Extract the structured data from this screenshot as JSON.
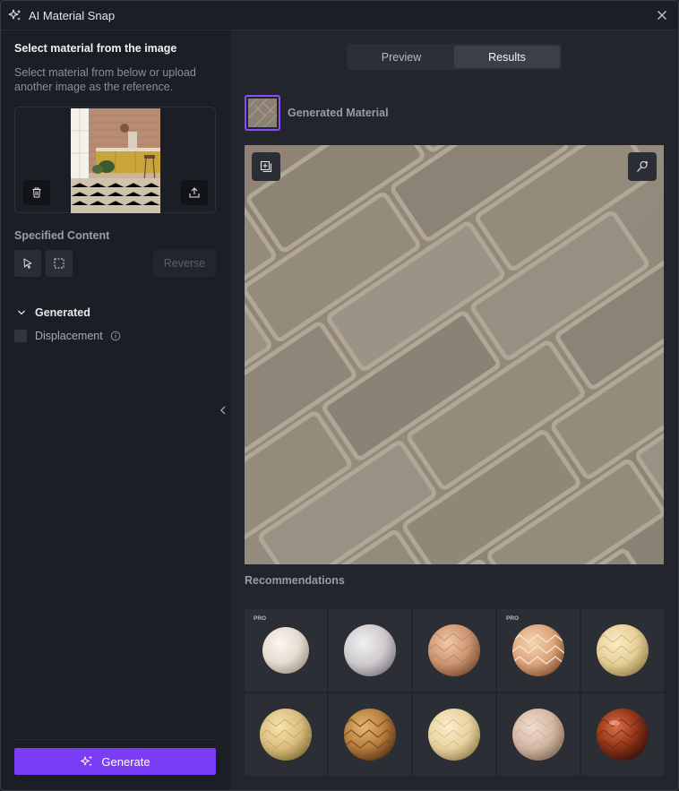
{
  "window": {
    "title": "AI Material Snap"
  },
  "left": {
    "section_title": "Select material from the image",
    "description": "Select material from below or upload another image as the reference.",
    "specified_content_title": "Specified Content",
    "reverse_label": "Reverse",
    "generated_title": "Generated",
    "displacement_label": "Displacement",
    "generate_label": "Generate"
  },
  "right": {
    "tabs": [
      {
        "label": "Preview"
      },
      {
        "label": "Results"
      }
    ],
    "active_tab": "Results",
    "generated_material_label": "Generated Material",
    "recommendations_title": "Recommendations",
    "recommendations": [
      {
        "pro": "PRO"
      },
      {
        "pro": ""
      },
      {
        "pro": ""
      },
      {
        "pro": "PRO"
      },
      {
        "pro": ""
      },
      {
        "pro": ""
      },
      {
        "pro": ""
      },
      {
        "pro": ""
      },
      {
        "pro": ""
      },
      {
        "pro": ""
      }
    ]
  },
  "colors": {
    "accent": "#7b3cf5",
    "thumb_border": "#8a4cf7"
  }
}
